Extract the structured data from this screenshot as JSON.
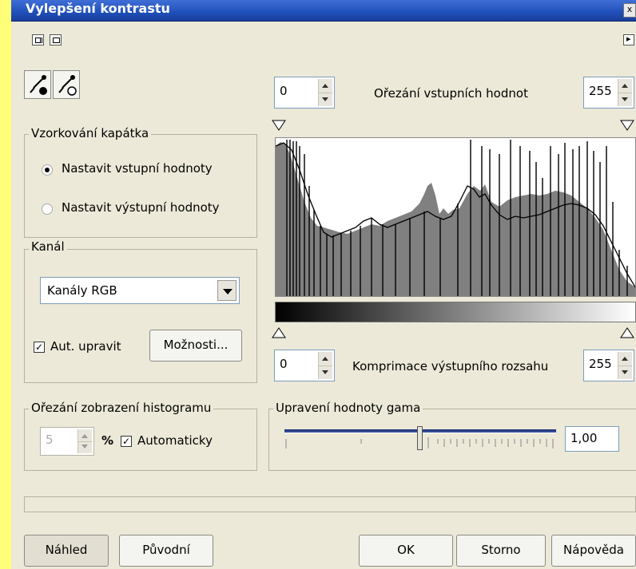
{
  "window": {
    "title": "Vylepšení kontrastu",
    "close_glyph": "x"
  },
  "toolbar": {
    "view_buttons": [
      "split-view-icon",
      "single-view-icon"
    ],
    "expand_glyph": "▸"
  },
  "eyedroppers": [
    "eyedropper-black-icon",
    "eyedropper-white-icon"
  ],
  "sampling": {
    "legend": "Vzorkování kapátka",
    "options": [
      {
        "label": "Nastavit vstupní hodnoty",
        "selected": true
      },
      {
        "label": "Nastavit výstupní hodnoty",
        "selected": false
      }
    ]
  },
  "channel": {
    "legend": "Kanál",
    "selected": "Kanály RGB",
    "auto_adjust_label": "Aut. upravit",
    "auto_adjust_checked": true,
    "options_button": "Možnosti..."
  },
  "histogram_clip": {
    "legend": "Ořezání zobrazení histogramu",
    "value": "5",
    "unit": "%",
    "auto_label": "Automaticky",
    "auto_checked": true
  },
  "input_clip": {
    "label": "Ořezání vstupních hodnot",
    "low": "0",
    "high": "255"
  },
  "output_range": {
    "label": "Komprimace výstupního rozsahu",
    "low": "0",
    "high": "255"
  },
  "gamma": {
    "legend": "Upravení hodnoty gama",
    "value": "1,00",
    "slider_position": 0.4
  },
  "buttons": {
    "preview": "Náhled",
    "original": "Původní",
    "ok": "OK",
    "cancel": "Storno",
    "help": "Nápověda"
  },
  "colors": {
    "title_bar": "#1f4fb8",
    "dialog_bg": "#ece9d8",
    "left_strip": "#ffff77",
    "histogram_fill": "#808080"
  }
}
